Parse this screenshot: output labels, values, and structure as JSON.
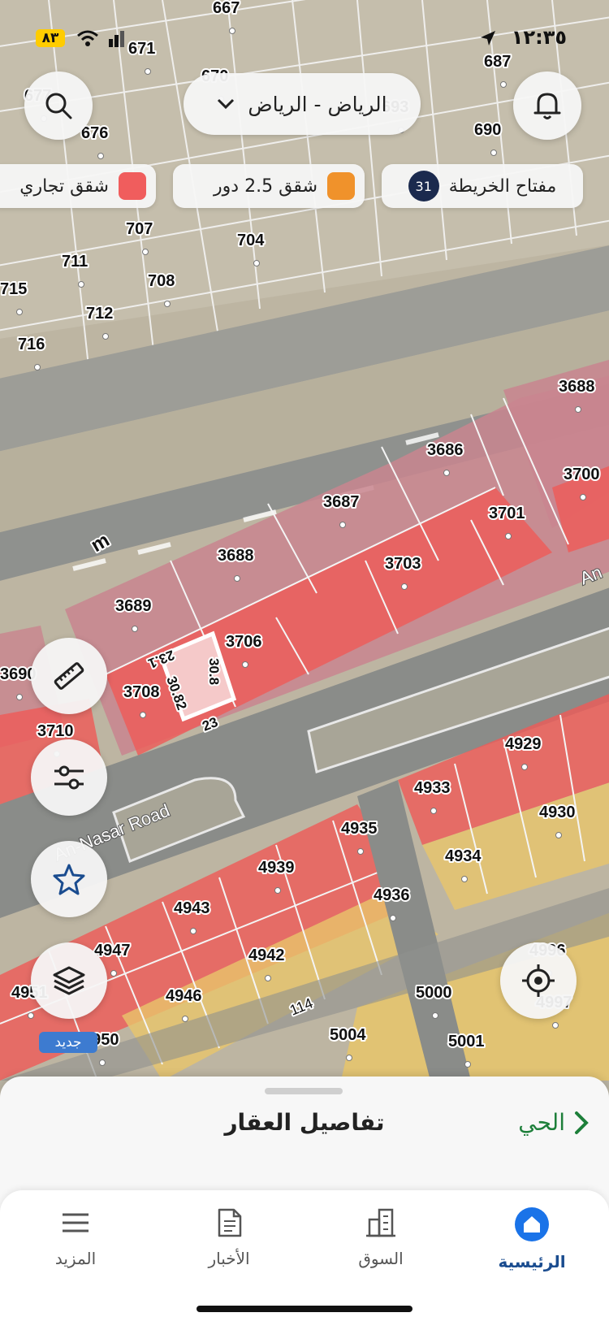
{
  "status_bar": {
    "battery": "٨٣",
    "time": "١٢:٣٥"
  },
  "location": {
    "label": "الرياض - الرياض"
  },
  "legend": {
    "key_label": "مفتاح الخريطة",
    "count": "31",
    "items": [
      {
        "label": "شقق 2.5 دور",
        "color": "#f0922b"
      },
      {
        "label": "شقق تجاري",
        "color": "#f05d5d"
      }
    ]
  },
  "map": {
    "road_label": "An-Nasar Road",
    "road_label_right": "An",
    "street_number": "114",
    "plot_dims": [
      "23.1",
      "30.8",
      "30.82",
      "23"
    ],
    "plots": [
      "667",
      "671",
      "670",
      "677",
      "676",
      "693",
      "687",
      "690",
      "707",
      "704",
      "711",
      "708",
      "715",
      "712",
      "716",
      "3686",
      "3687",
      "3688",
      "3689",
      "3701",
      "3703",
      "3706",
      "3708",
      "3710",
      "3690",
      "3688",
      "3700",
      "4929",
      "4933",
      "4930",
      "4935",
      "4934",
      "4939",
      "4936",
      "4943",
      "4942",
      "4947",
      "4946",
      "4951",
      "4950",
      "4996",
      "4997",
      "5000",
      "5004",
      "5001"
    ]
  },
  "tools": {
    "layers_badge": "جديد"
  },
  "sheet": {
    "title": "تفاصيل العقار",
    "link": "الحي"
  },
  "tabs": [
    {
      "label": "الرئيسية",
      "icon": "home-icon"
    },
    {
      "label": "السوق",
      "icon": "buildings-icon"
    },
    {
      "label": "الأخبار",
      "icon": "news-icon"
    },
    {
      "label": "المزيد",
      "icon": "menu-icon"
    }
  ],
  "colors": {
    "accent": "#1a4c8f",
    "link": "#1d7f3a",
    "commercial": "#f05d5d",
    "residential_plot": "#c9858f",
    "apartments": "#e8c56b"
  }
}
